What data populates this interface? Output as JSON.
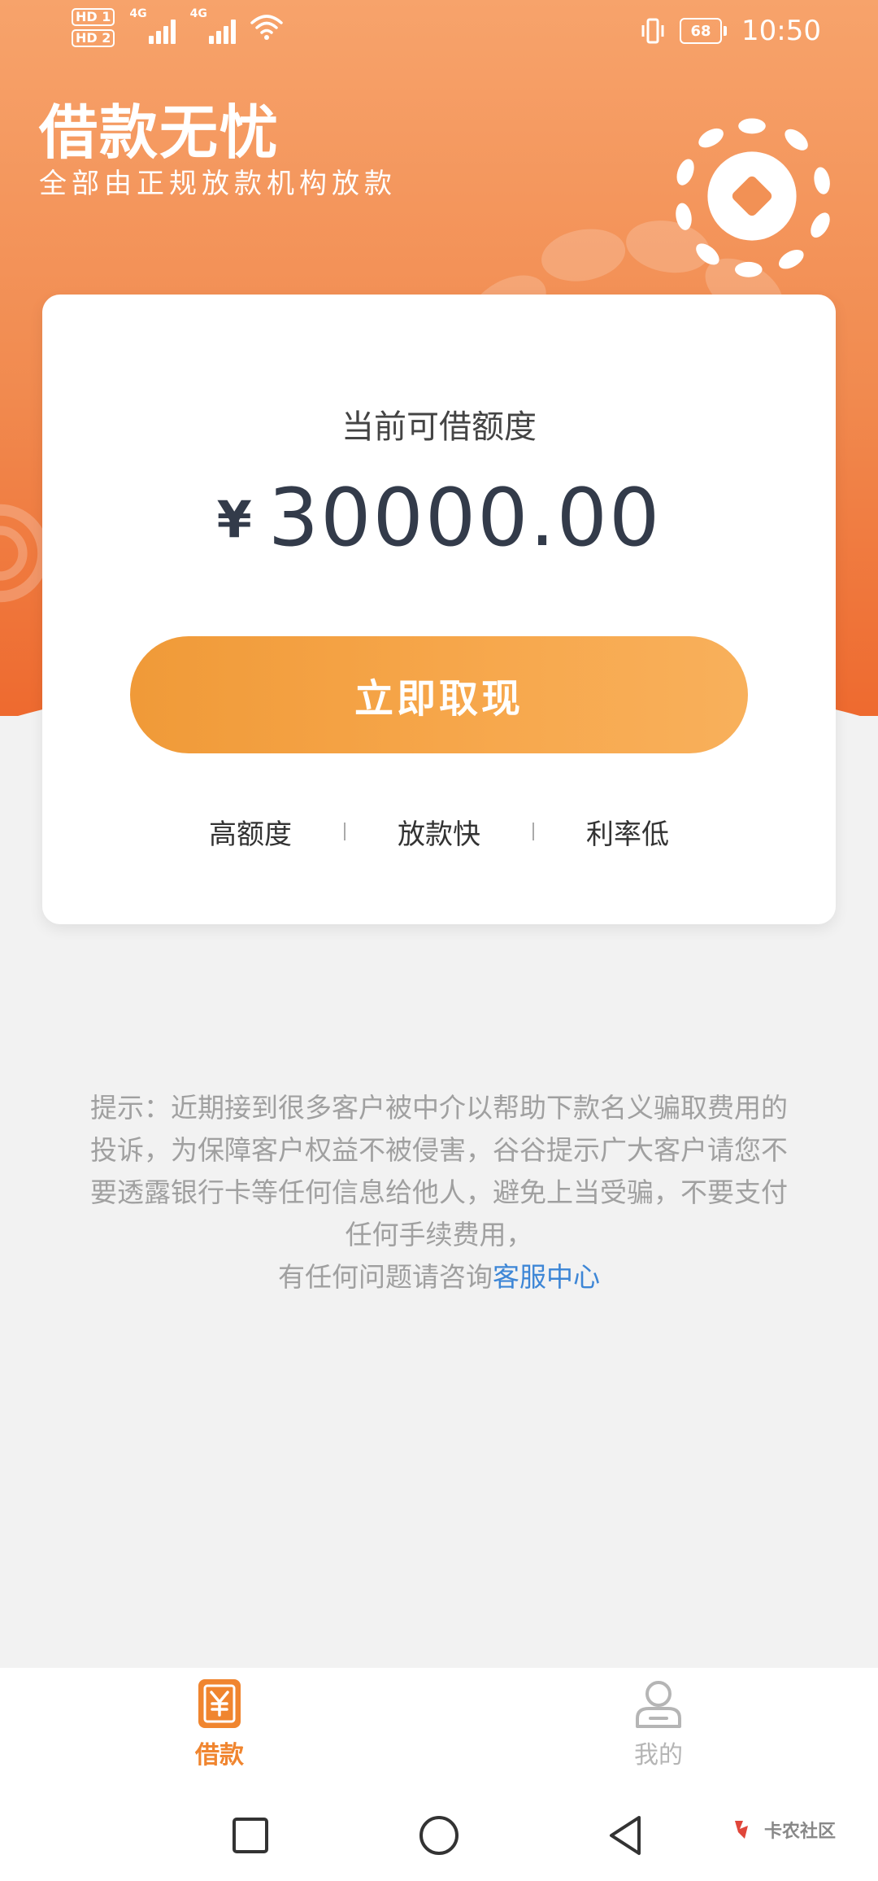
{
  "status_bar": {
    "sim1": "HD 1",
    "sim2": "HD 2",
    "network1": "4G",
    "network2": "4G",
    "battery": "68",
    "time": "10:50"
  },
  "header": {
    "title": "借款无忧",
    "subtitle": "全部由正规放款机构放款"
  },
  "card": {
    "label": "当前可借额度",
    "currency": "¥",
    "amount": "30000.00",
    "button_label": "立即取现",
    "features": [
      "高额度",
      "放款快",
      "利率低"
    ]
  },
  "notice": {
    "text": "提示：近期接到很多客户被中介以帮助下款名义骗取费用的投诉，为保障客户权益不被侵害，谷谷提示广大客户请您不要透露银行卡等任何信息给他人，避免上当受骗，不要支付任何手续费用，",
    "contact_prefix": "有任何问题请咨询",
    "contact_link": "客服中心"
  },
  "tabs": [
    {
      "label": "借款",
      "icon": "yuan-icon",
      "active": true
    },
    {
      "label": "我的",
      "icon": "user-icon",
      "active": false
    }
  ],
  "watermark": {
    "label": "卡农社区"
  },
  "colors": {
    "accent": "#f0852f",
    "link": "#3d86d6",
    "header_start": "#f7a36b",
    "header_end": "#ee6a2f"
  }
}
